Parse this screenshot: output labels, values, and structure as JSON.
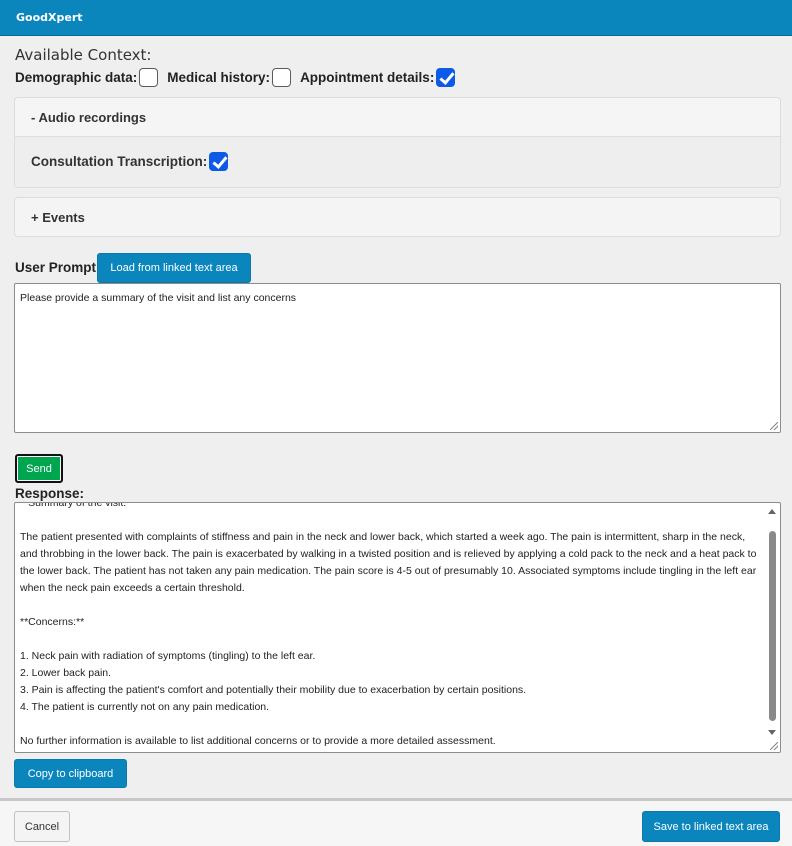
{
  "app": {
    "title": "GoodXpert"
  },
  "context": {
    "heading": "Available Context:",
    "options": [
      {
        "label": "Demographic data:",
        "checked": false
      },
      {
        "label": "Medical history:",
        "checked": false
      },
      {
        "label": "Appointment details:",
        "checked": true
      }
    ]
  },
  "audio_panel": {
    "title": "- Audio recordings",
    "transcription_label": "Consultation Transcription:",
    "transcription_checked": true
  },
  "events_panel": {
    "title": "+ Events"
  },
  "prompt": {
    "label": "User Prompt:",
    "load_button": "Load from linked text area",
    "value": "Please provide a summary of the visit and list any concerns"
  },
  "send_button": "Send",
  "response": {
    "label": "Response:",
    "lines": [
      "**Summary of the visit:**",
      "The patient presented with complaints of stiffness and pain in the neck and lower back, which started a week ago. The pain is intermittent, sharp in the neck, and throbbing in the lower back. The pain is exacerbated by walking in a twisted position and is relieved by applying a cold pack to the neck and a heat pack to the lower back. The patient has not taken any pain medication. The pain score is 4-5 out of presumably 10. Associated symptoms include tingling in the left ear when the neck pain exceeds a certain threshold.",
      "**Concerns:**",
      "1. Neck pain with radiation of symptoms (tingling) to the left ear.",
      "2. Lower back pain.",
      "3. Pain is affecting the patient's comfort and potentially their mobility due to exacerbation by certain positions.",
      "4. The patient is currently not on any pain medication.",
      "No further information is available to list additional concerns or to provide a more detailed assessment."
    ]
  },
  "copy_button": "Copy to clipboard",
  "footer": {
    "cancel_button": "Cancel",
    "save_button": "Save to linked text area"
  },
  "colors": {
    "accent": "#0a86bd",
    "send": "#00a54f",
    "checkbox_checked": "#0d5ae6"
  },
  "icons": {
    "checkbox_checked": "checkmark-icon",
    "scroll_up": "chevron-up-icon",
    "scroll_down": "chevron-down-icon",
    "resize": "resize-grip-icon"
  }
}
